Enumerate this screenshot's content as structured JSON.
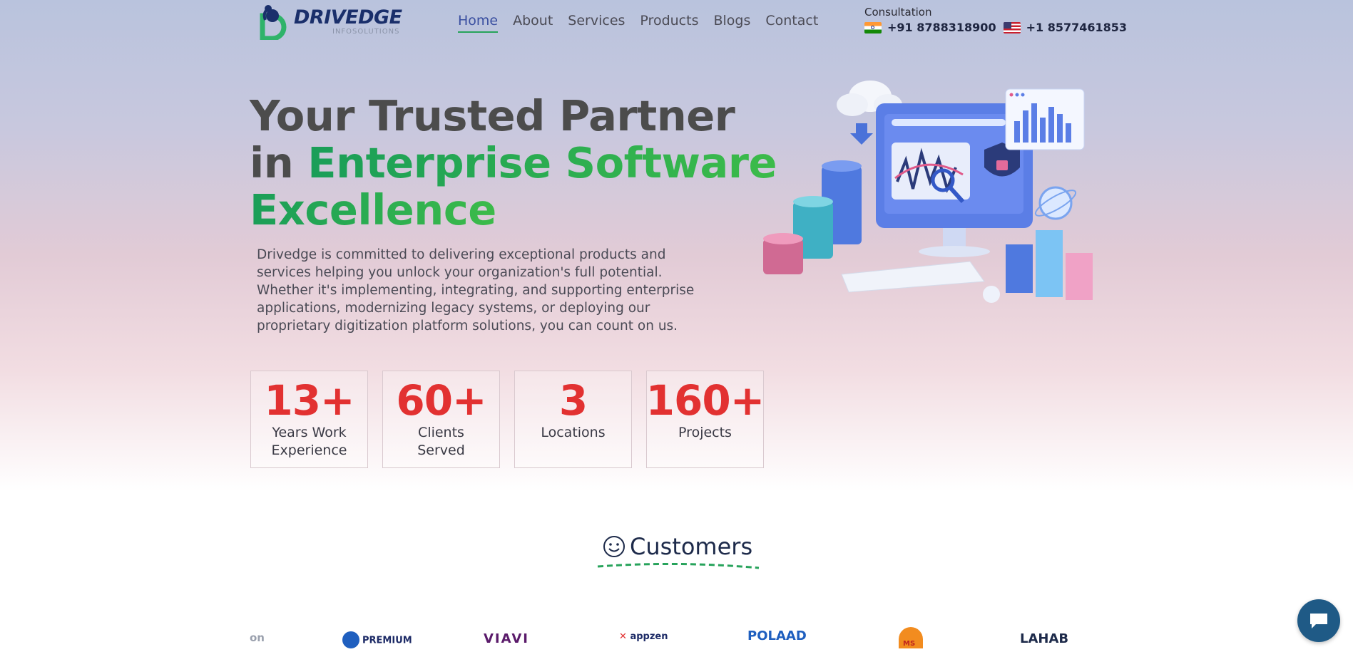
{
  "brand": {
    "name": "DRIVEDGE",
    "sub": "INFOSOLUTIONS",
    "logo_letter": "D"
  },
  "nav": {
    "items": [
      {
        "label": "Home",
        "active": true
      },
      {
        "label": "About"
      },
      {
        "label": "Services"
      },
      {
        "label": "Products"
      },
      {
        "label": "Blogs"
      },
      {
        "label": "Contact"
      }
    ]
  },
  "contact": {
    "label": "Consultation",
    "phone_india": "+91 8788318900",
    "phone_us": "+1 8577461853"
  },
  "hero": {
    "title_line1": "Your Trusted Partner",
    "title_line2_plain": "in ",
    "title_line2_green": "Enterprise Software",
    "title_line3_green": "Excellence",
    "description": "Drivedge is committed to delivering exceptional products and services helping you unlock your organization's full potential. Whether it's implementing, integrating, and supporting enterprise applications, modernizing legacy systems, or deploying our proprietary digitization platform solutions, you can count on us."
  },
  "stats": [
    {
      "value": "13+",
      "label": "Years Work Experience"
    },
    {
      "value": "60+",
      "label": "Clients Served"
    },
    {
      "value": "3",
      "label": "Locations"
    },
    {
      "value": "160+",
      "label": "Projects"
    }
  ],
  "customers": {
    "title": "Customers",
    "logos": [
      "on",
      "PREMIUM",
      "VIAVI",
      "appzen",
      "POLAAD",
      "MS",
      "LAHAB"
    ]
  },
  "colors": {
    "accent_green": "#27a35b",
    "stat_red": "#e23131",
    "brand_navy": "#1a2f6b",
    "chat_blue": "#1f5a86"
  }
}
